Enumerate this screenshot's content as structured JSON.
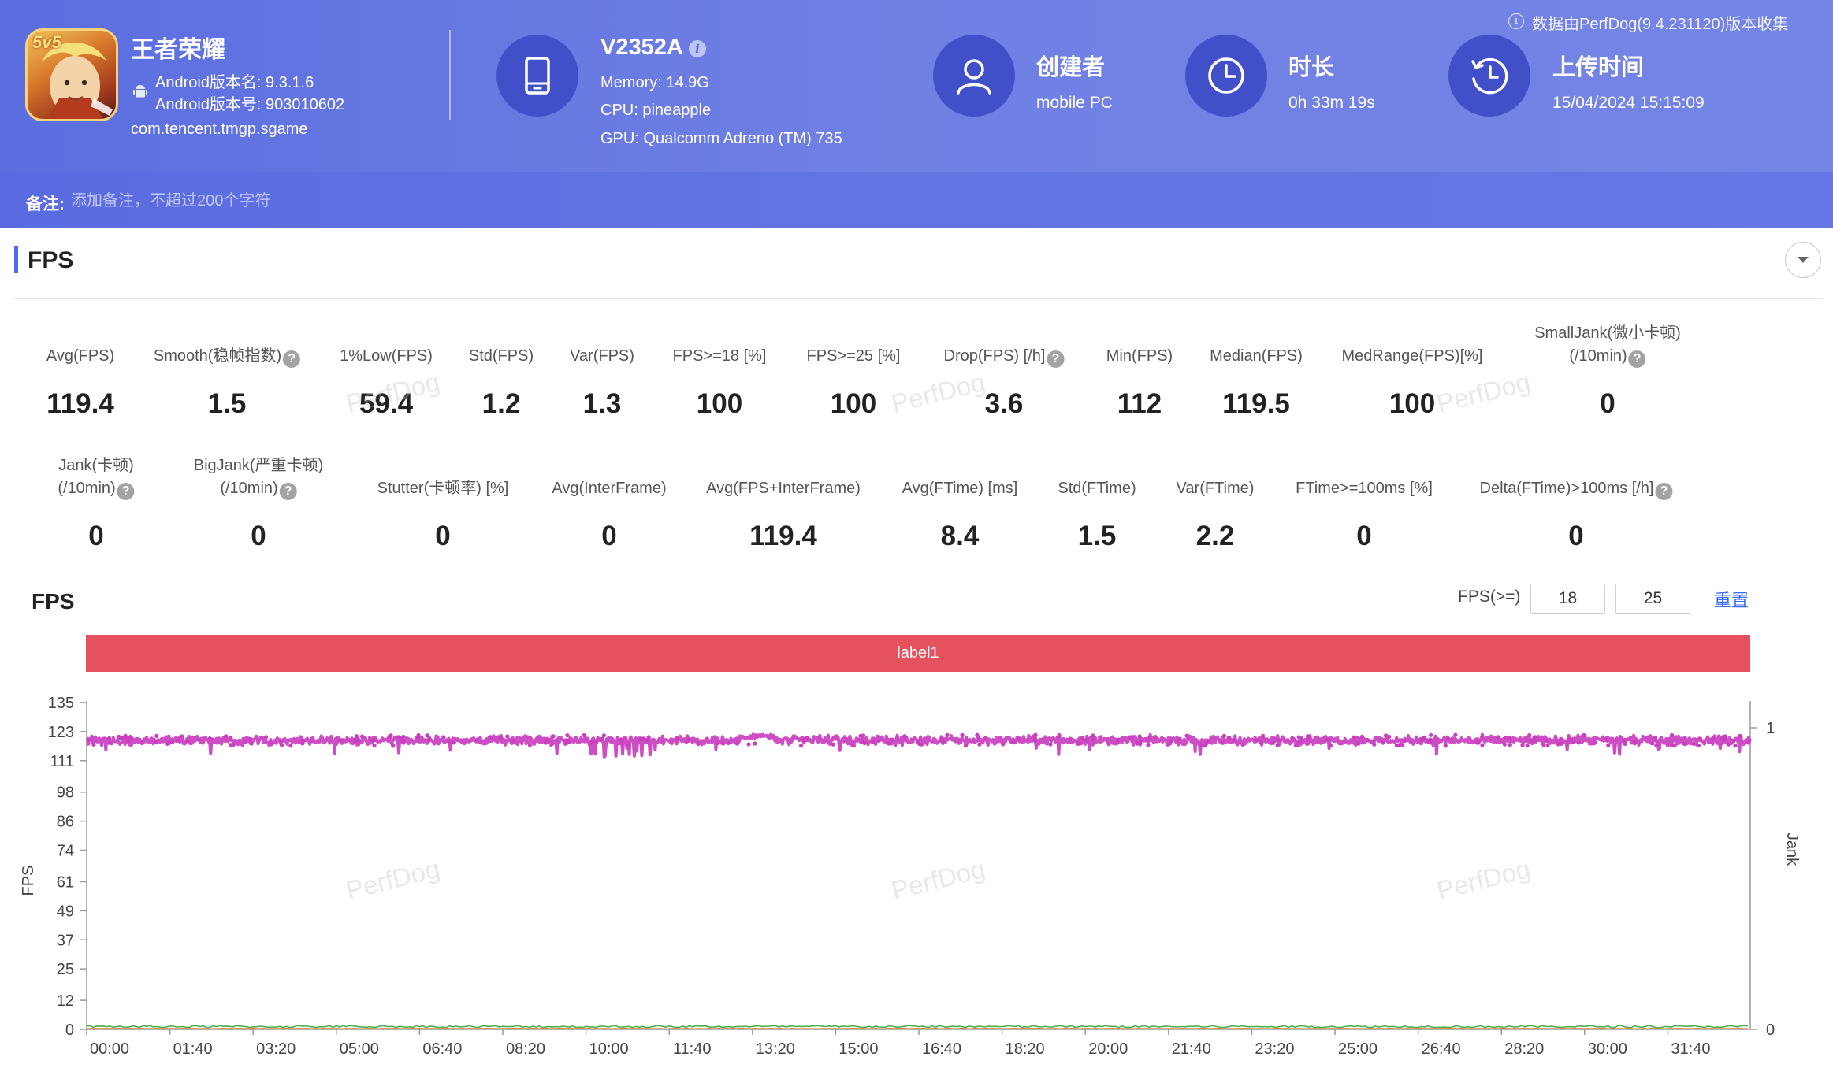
{
  "header": {
    "app": {
      "name": "王者荣耀",
      "version_name": "Android版本名: 9.3.1.6",
      "version_code": "Android版本号: 903010602",
      "package": "com.tencent.tmgp.sgame",
      "icon_badge": "5v5"
    },
    "device": {
      "name": "V2352A",
      "info_icon": "i",
      "memory": "Memory: 14.9G",
      "cpu": "CPU: pineapple",
      "gpu": "GPU: Qualcomm Adreno (TM) 735"
    },
    "creator": {
      "title": "创建者",
      "value": "mobile PC"
    },
    "duration": {
      "title": "时长",
      "value": "0h 33m 19s"
    },
    "upload": {
      "title": "上传时间",
      "value": "15/04/2024 15:15:09"
    },
    "source_note": "数据由PerfDog(9.4.231120)版本收集",
    "source_icon": "i",
    "note_label": "备注:",
    "note_placeholder": "添加备注，不超过200个字符"
  },
  "section": {
    "title": "FPS"
  },
  "metrics_row1": [
    {
      "label": "Avg(FPS)",
      "value": "119.4"
    },
    {
      "label": "Smooth(稳帧指数)",
      "value": "1.5",
      "help": true
    },
    {
      "label": "1%Low(FPS)",
      "value": "59.4"
    },
    {
      "label": "Std(FPS)",
      "value": "1.2"
    },
    {
      "label": "Var(FPS)",
      "value": "1.3"
    },
    {
      "label": "FPS>=18 [%]",
      "value": "100"
    },
    {
      "label": "FPS>=25 [%]",
      "value": "100"
    },
    {
      "label": "Drop(FPS) [/h]",
      "value": "3.6",
      "help": true
    },
    {
      "label": "Min(FPS)",
      "value": "112"
    },
    {
      "label": "Median(FPS)",
      "value": "119.5"
    },
    {
      "label": "MedRange(FPS)[%]",
      "value": "100"
    },
    {
      "label": "SmallJank(微小卡顿)",
      "label2": "(/10min)",
      "value": "0",
      "help": true
    }
  ],
  "metrics_row2": [
    {
      "label": "Jank(卡顿)",
      "label2": "(/10min)",
      "value": "0",
      "help": true
    },
    {
      "label": "BigJank(严重卡顿)",
      "label2": "(/10min)",
      "value": "0",
      "help": true
    },
    {
      "label": "Stutter(卡顿率) [%]",
      "value": "0"
    },
    {
      "label": "Avg(InterFrame)",
      "value": "0"
    },
    {
      "label": "Avg(FPS+InterFrame)",
      "value": "119.4"
    },
    {
      "label": "Avg(FTime) [ms]",
      "value": "8.4"
    },
    {
      "label": "Std(FTime)",
      "value": "1.5"
    },
    {
      "label": "Var(FTime)",
      "value": "2.2"
    },
    {
      "label": "FTime>=100ms [%]",
      "value": "0"
    },
    {
      "label": "Delta(FTime)>100ms [/h]",
      "value": "0",
      "help": true
    }
  ],
  "help_glyph": "?",
  "chart_panel": {
    "title": "FPS",
    "threshold_label": "FPS(>=)",
    "threshold_1": "18",
    "threshold_2": "25",
    "reset_label": "重置",
    "band_label": "label1",
    "watermark": "PerfDog"
  },
  "chart_data": {
    "type": "line",
    "title": "FPS",
    "ylabel": "FPS",
    "y2label": "Jank",
    "ylim": [
      0,
      135
    ],
    "y2lim": [
      0,
      1
    ],
    "yticks": [
      "135",
      "123",
      "111",
      "98",
      "86",
      "74",
      "61",
      "49",
      "37",
      "25",
      "12",
      "0"
    ],
    "y2ticks": [
      "1",
      "0"
    ],
    "xticks": [
      "00:00",
      "01:40",
      "03:20",
      "05:00",
      "06:40",
      "08:20",
      "10:00",
      "11:40",
      "13:20",
      "15:00",
      "16:40",
      "18:20",
      "20:00",
      "21:40",
      "23:20",
      "25:00",
      "26:40",
      "28:20",
      "30:00",
      "31:40"
    ],
    "xrange_seconds": [
      0,
      1999
    ],
    "series": [
      {
        "color": "#c93fbf",
        "avg": 119.4,
        "min": 112,
        "std": 1.2
      },
      {
        "color": "#4caf50",
        "approx_value": 0.6
      },
      {
        "color": "#e08a3c",
        "approx_value": 0.3
      }
    ]
  }
}
